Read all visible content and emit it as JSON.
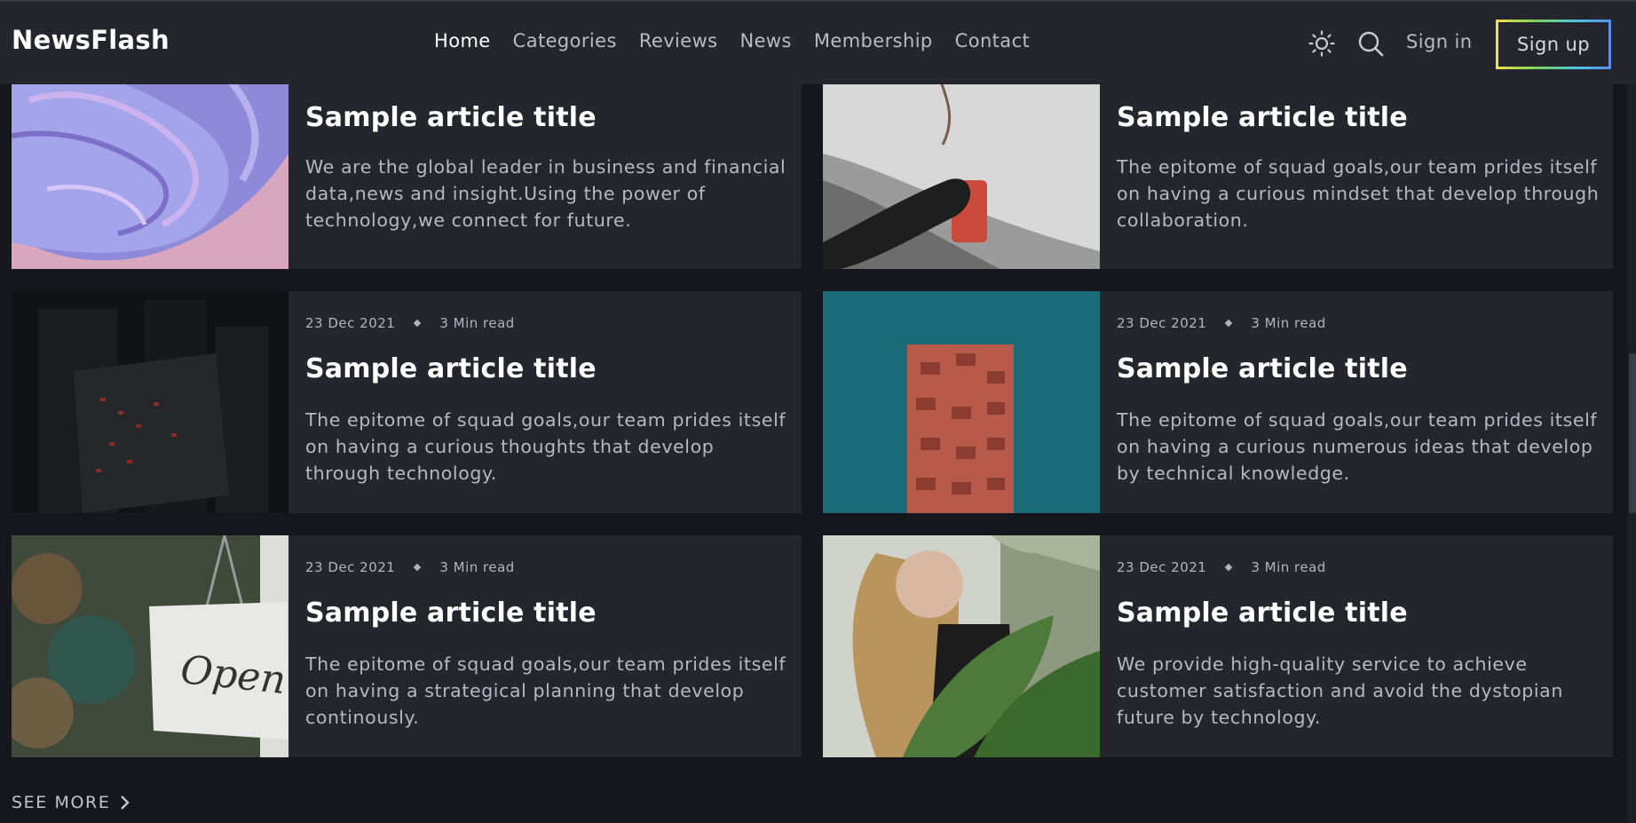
{
  "header": {
    "logo": "NewsFlash",
    "nav": [
      "Home",
      "Categories",
      "Reviews",
      "News",
      "Membership",
      "Contact"
    ],
    "active_nav": "Home",
    "sign_in": "Sign in",
    "sign_up": "Sign up"
  },
  "articles": [
    {
      "date": "",
      "read_time": "",
      "title": "Sample article title",
      "description": "We are the global leader in business and financial data,news and insight.Using the power of technology,we connect for future.",
      "image": "purple-paint-swirl"
    },
    {
      "date": "",
      "read_time": "",
      "title": "Sample article title",
      "description": "The epitome of squad goals,our team prides itself on having a curious mindset that develop through collaboration.",
      "image": "hand-holding-red-cup-in-snow"
    },
    {
      "date": "23 Dec 2021",
      "read_time": "3 Min read",
      "title": "Sample article title",
      "description": "The epitome of squad goals,our team prides itself on having a curious thoughts that develop through technology.",
      "image": "dark-city-buildings"
    },
    {
      "date": "23 Dec 2021",
      "read_time": "3 Min read",
      "title": "Sample article title",
      "description": "The epitome of squad goals,our team prides itself on having a curious numerous ideas that develop by technical knowledge.",
      "image": "red-brick-tower-teal-sky"
    },
    {
      "date": "23 Dec 2021",
      "read_time": "3 Min read",
      "title": "Sample article title",
      "description": "The epitome of squad goals,our team prides itself on having a strategical planning that develop continously.",
      "image": "open-sign-hanging"
    },
    {
      "date": "23 Dec 2021",
      "read_time": "3 Min read",
      "title": "Sample article title",
      "description": "We provide high-quality service to achieve customer satisfaction and avoid the dystopian future by technology.",
      "image": "woman-with-plants"
    }
  ],
  "see_more": "SEE MORE",
  "icons": [
    "sun-icon",
    "search-icon",
    "chevron-right-icon"
  ],
  "colors": {
    "background": "#16171c",
    "card": "#24252d",
    "header": "#24252d",
    "text": "#ffffff",
    "muted": "#b6b9c3"
  }
}
